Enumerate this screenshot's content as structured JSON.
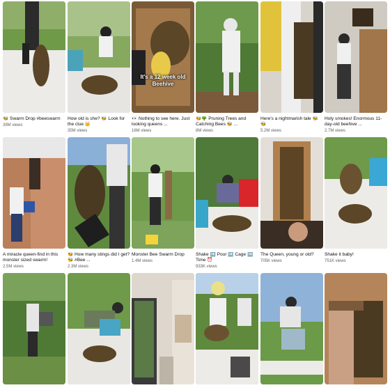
{
  "shorts": [
    {
      "title": "🐝 Swarm Drop #beeswarm",
      "views": "39M views",
      "overlay": ""
    },
    {
      "title": "How old is she? 🐝 Look for the clue 👑",
      "views": "35M views",
      "overlay": ""
    },
    {
      "title": "👀 Nothing to see here. Just looking queens ...",
      "views": "16M views",
      "overlay": "It's a 12 week old Beehive"
    },
    {
      "title": "🐝🌳 Pruning Trees and Catching Bees 🐝 ...",
      "views": "8M views",
      "overlay": ""
    },
    {
      "title": "Here's a nightmarish tale 🐝 🐝",
      "views": "5.2M views",
      "overlay": ""
    },
    {
      "title": "Holy smokes! Enormous 11-day-old beehive ...",
      "views": "2.7M views",
      "overlay": ""
    },
    {
      "title": "A miracle queen-find in this monster sized swarm!",
      "views": "2.5M views",
      "overlay": ""
    },
    {
      "title": "🐝 How many stings did I get? 🐝 #Bee ...",
      "views": "2.3M views",
      "overlay": ""
    },
    {
      "title": "Monster Bee Swarm Drop",
      "views": "1.4M views",
      "overlay": ""
    },
    {
      "title": "Shake ➡️ Pour ➡️ Cage ➡️ Time ⏰",
      "views": "933K views",
      "overlay": ""
    },
    {
      "title": "The Queen, young or old?",
      "views": "705K views",
      "overlay": ""
    },
    {
      "title": "Shake it baby!",
      "views": "751K views",
      "overlay": ""
    },
    {
      "title": "",
      "views": "",
      "overlay": ""
    },
    {
      "title": "",
      "views": "",
      "overlay": ""
    },
    {
      "title": "",
      "views": "",
      "overlay": ""
    },
    {
      "title": "",
      "views": "",
      "overlay": ""
    },
    {
      "title": "",
      "views": "",
      "overlay": ""
    },
    {
      "title": "",
      "views": "",
      "overlay": ""
    }
  ],
  "colors": {
    "text_primary": "#0f0f0f",
    "text_secondary": "#606060",
    "grass": "#5f8f3a",
    "bees": "#4a3a22",
    "sheet": "#e8e6e2"
  }
}
